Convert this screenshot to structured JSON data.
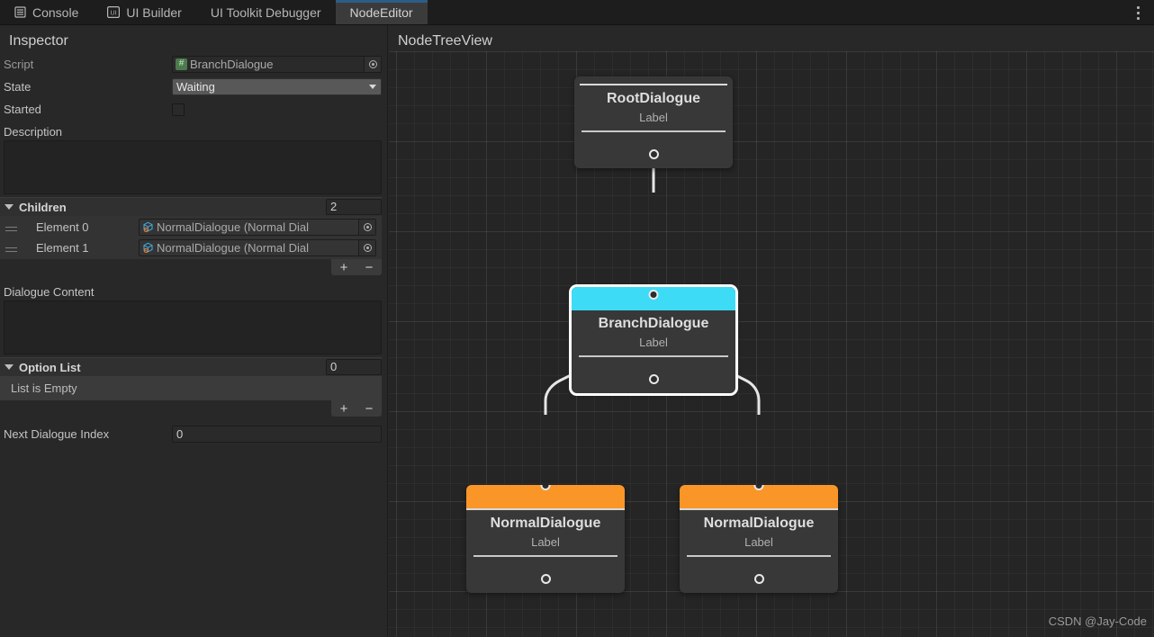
{
  "tabs": [
    {
      "label": "Console",
      "icon": "console-icon",
      "active": false
    },
    {
      "label": "UI Builder",
      "icon": "ui-builder-icon",
      "active": false
    },
    {
      "label": "UI Toolkit Debugger",
      "icon": "none",
      "active": false
    },
    {
      "label": "NodeEditor",
      "icon": "none",
      "active": true
    }
  ],
  "window_menu_icon": "kebab-menu-icon",
  "inspector": {
    "title": "Inspector",
    "script": {
      "label": "Script",
      "value": "BranchDialogue",
      "icon": "csharp-script-icon",
      "picker_icon": "object-picker-icon"
    },
    "state": {
      "label": "State",
      "value": "Waiting",
      "caret_icon": "chevron-down-icon"
    },
    "started": {
      "label": "Started",
      "checked": false
    },
    "description": {
      "label": "Description",
      "value": ""
    },
    "children": {
      "label": "Children",
      "size": "2",
      "expanded": true,
      "items": [
        {
          "name": "Element 0",
          "value": "NormalDialogue (Normal Dial",
          "icon": "prefab-cube-icon",
          "picker_icon": "object-picker-icon"
        },
        {
          "name": "Element 1",
          "value": "NormalDialogue (Normal Dial",
          "icon": "prefab-cube-icon",
          "picker_icon": "object-picker-icon"
        }
      ],
      "add_label": "+",
      "remove_label": "−"
    },
    "dialogue_content": {
      "label": "Dialogue Content",
      "value": ""
    },
    "option_list": {
      "label": "Option List",
      "size": "0",
      "expanded": true,
      "empty_text": "List is Empty",
      "add_label": "+",
      "remove_label": "−"
    },
    "next_dialogue_index": {
      "label": "Next Dialogue Index",
      "value": "0"
    }
  },
  "graph": {
    "title": "NodeTreeView",
    "watermark": "CSDN @Jay-Code",
    "nodes": [
      {
        "id": "root",
        "name": "RootDialogue",
        "label": "Label",
        "header_color": "none",
        "selected": false,
        "has_input": false,
        "has_output": true,
        "output_style": "filled"
      },
      {
        "id": "branch",
        "name": "BranchDialogue",
        "label": "Label",
        "header_color": "#3ddbf5",
        "selected": true,
        "has_input": true,
        "has_output": true,
        "output_style": "filled"
      },
      {
        "id": "norm1",
        "name": "NormalDialogue",
        "label": "Label",
        "header_color": "#fa9528",
        "selected": false,
        "has_input": true,
        "has_output": true,
        "output_style": "hollow"
      },
      {
        "id": "norm2",
        "name": "NormalDialogue",
        "label": "Label",
        "header_color": "#fa9528",
        "selected": false,
        "has_input": true,
        "has_output": true,
        "output_style": "hollow"
      }
    ],
    "edge_color": "#e6e6e6"
  }
}
